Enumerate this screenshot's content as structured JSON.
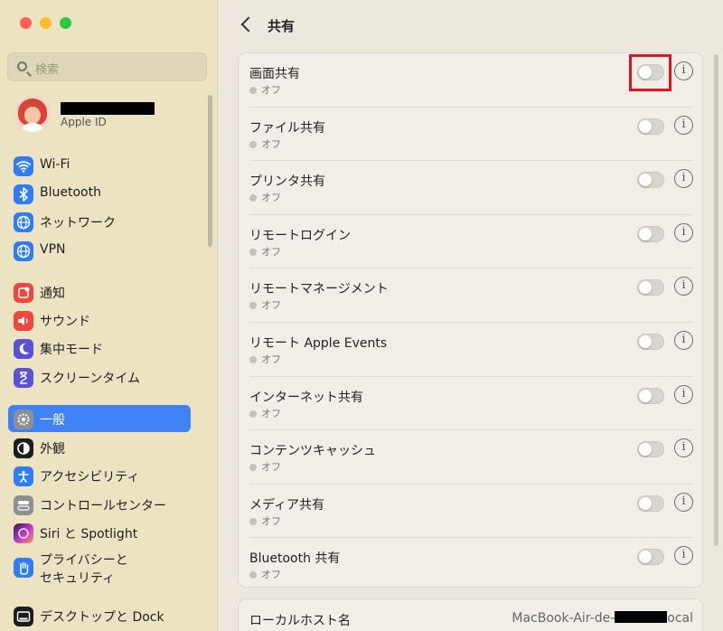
{
  "window": {
    "title": "共有"
  },
  "search": {
    "placeholder": "検索"
  },
  "apple_id": {
    "label": "Apple ID"
  },
  "sidebar": {
    "items": [
      {
        "label": "Wi-Fi",
        "icon": "wifi-icon",
        "color": "#2f7cf6"
      },
      {
        "label": "Bluetooth",
        "icon": "bluetooth-icon",
        "color": "#2f7cf6"
      },
      {
        "label": "ネットワーク",
        "icon": "globe-icon",
        "color": "#2f7cf6"
      },
      {
        "label": "VPN",
        "icon": "vpn-icon",
        "color": "#2f7cf6"
      },
      {
        "label": "通知",
        "icon": "bell-icon",
        "color": "#f0463d"
      },
      {
        "label": "サウンド",
        "icon": "speaker-icon",
        "color": "#f0463d"
      },
      {
        "label": "集中モード",
        "icon": "moon-icon",
        "color": "#5b51d8"
      },
      {
        "label": "スクリーンタイム",
        "icon": "hourglass-icon",
        "color": "#5b51d8"
      },
      {
        "label": "一般",
        "icon": "gear-icon",
        "color": "#8e8e93",
        "selected": true
      },
      {
        "label": "外観",
        "icon": "appearance-icon",
        "color": "#1c1c1e"
      },
      {
        "label": "アクセシビリティ",
        "icon": "accessibility-icon",
        "color": "#2f7cf6"
      },
      {
        "label": "コントロールセンター",
        "icon": "control-center-icon",
        "color": "#8e8e93"
      },
      {
        "label": "Siri と Spotlight",
        "icon": "siri-icon",
        "color": "#c43bd0"
      },
      {
        "label": "プライバシーと\nセキュリティ",
        "icon": "hand-icon",
        "color": "#2f7cf6"
      },
      {
        "label": "デスクトップと Dock",
        "icon": "dock-icon",
        "color": "#1c1c1e"
      }
    ]
  },
  "sharing": {
    "items": [
      {
        "name": "画面共有",
        "status": "オフ",
        "enabled": false
      },
      {
        "name": "ファイル共有",
        "status": "オフ",
        "enabled": false
      },
      {
        "name": "プリンタ共有",
        "status": "オフ",
        "enabled": false
      },
      {
        "name": "リモートログイン",
        "status": "オフ",
        "enabled": false
      },
      {
        "name": "リモートマネージメント",
        "status": "オフ",
        "enabled": false
      },
      {
        "name": "リモート Apple Events",
        "status": "オフ",
        "enabled": false
      },
      {
        "name": "インターネット共有",
        "status": "オフ",
        "enabled": false
      },
      {
        "name": "コンテンツキャッシュ",
        "status": "オフ",
        "enabled": false
      },
      {
        "name": "メディア共有",
        "status": "オフ",
        "enabled": false
      },
      {
        "name": "Bluetooth 共有",
        "status": "オフ",
        "enabled": false
      }
    ]
  },
  "local_hostname": {
    "label": "ローカルホスト名",
    "value_prefix": "MacBook-Air-de-",
    "value_suffix": "ocal"
  },
  "colors": {
    "accent": "#3f82f6",
    "highlight": "#e0141e"
  }
}
